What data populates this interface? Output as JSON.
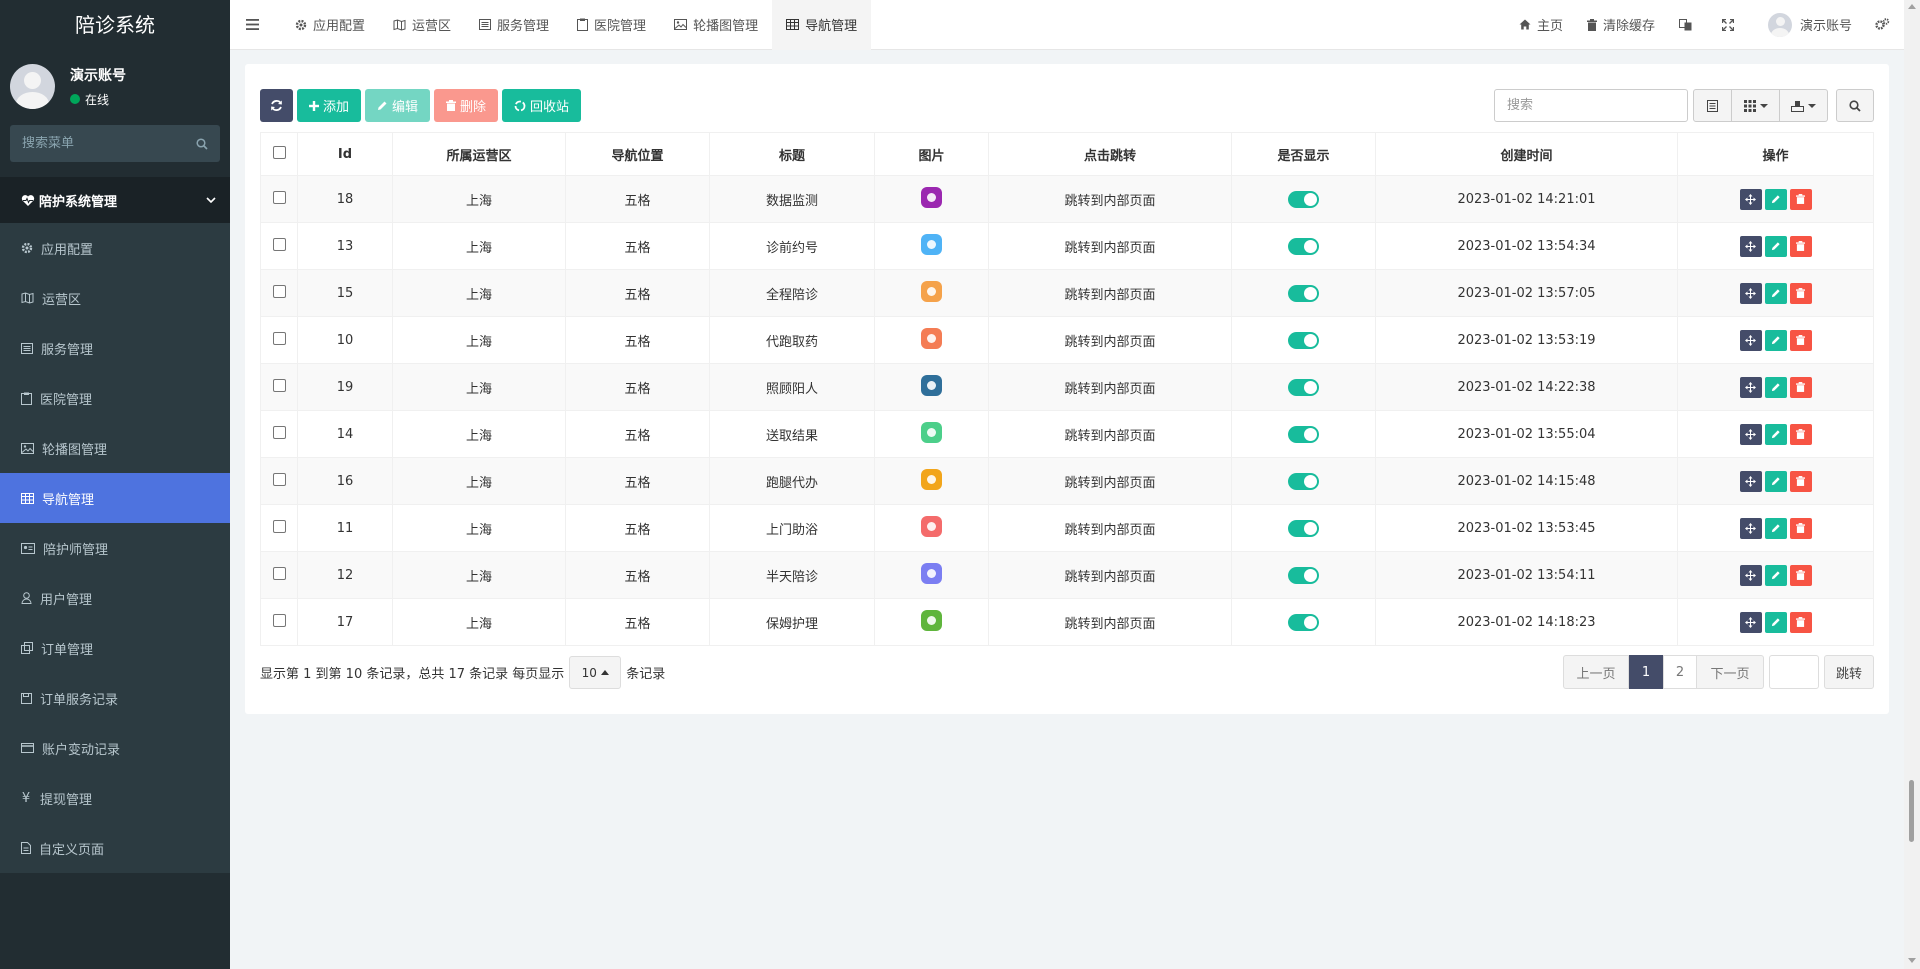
{
  "app": {
    "logo_title": "陪诊系统"
  },
  "user": {
    "name": "演示账号",
    "status": "在线"
  },
  "sidebar": {
    "search_placeholder": "搜索菜单",
    "group_label": "陪护系统管理",
    "items": [
      {
        "label": "应用配置",
        "icon": "gear-icon"
      },
      {
        "label": "运营区",
        "icon": "map-icon"
      },
      {
        "label": "服务管理",
        "icon": "list-icon"
      },
      {
        "label": "医院管理",
        "icon": "clipboard-icon"
      },
      {
        "label": "轮播图管理",
        "icon": "image-icon"
      },
      {
        "label": "导航管理",
        "icon": "table-icon",
        "active": true
      },
      {
        "label": "陪护师管理",
        "icon": "id-card-icon"
      },
      {
        "label": "用户管理",
        "icon": "user-icon"
      },
      {
        "label": "订单管理",
        "icon": "copy-icon"
      },
      {
        "label": "订单服务记录",
        "icon": "save-icon"
      },
      {
        "label": "账户变动记录",
        "icon": "credit-card-icon"
      },
      {
        "label": "提现管理",
        "icon": "yen-icon"
      },
      {
        "label": "自定义页面",
        "icon": "file-icon"
      }
    ]
  },
  "header": {
    "tabs": [
      {
        "label": "应用配置"
      },
      {
        "label": "运营区"
      },
      {
        "label": "服务管理"
      },
      {
        "label": "医院管理"
      },
      {
        "label": "轮播图管理"
      },
      {
        "label": "导航管理",
        "active": true
      }
    ],
    "home_label": "主页",
    "clear_cache_label": "清除缓存",
    "account_label": "演示账号"
  },
  "toolbar": {
    "add_label": "添加",
    "edit_label": "编辑",
    "delete_label": "删除",
    "recycle_label": "回收站",
    "search_placeholder": "搜索"
  },
  "table": {
    "columns": [
      "Id",
      "所属运营区",
      "导航位置",
      "标题",
      "图片",
      "点击跳转",
      "是否显示",
      "创建时间",
      "操作"
    ],
    "rows": [
      {
        "id": "18",
        "region": "上海",
        "position": "五格",
        "title": "数据监测",
        "icon_color": "#9b27b0",
        "jump": "跳转到内部页面",
        "time": "2023-01-02 14:21:01"
      },
      {
        "id": "13",
        "region": "上海",
        "position": "五格",
        "title": "诊前约号",
        "icon_color": "#4fb3f6",
        "jump": "跳转到内部页面",
        "time": "2023-01-02 13:54:34"
      },
      {
        "id": "15",
        "region": "上海",
        "position": "五格",
        "title": "全程陪诊",
        "icon_color": "#f5a24a",
        "jump": "跳转到内部页面",
        "time": "2023-01-02 13:57:05"
      },
      {
        "id": "10",
        "region": "上海",
        "position": "五格",
        "title": "代跑取药",
        "icon_color": "#f47c54",
        "jump": "跳转到内部页面",
        "time": "2023-01-02 13:53:19"
      },
      {
        "id": "19",
        "region": "上海",
        "position": "五格",
        "title": "照顾阳人",
        "icon_color": "#2f6f9a",
        "jump": "跳转到内部页面",
        "time": "2023-01-02 14:22:38"
      },
      {
        "id": "14",
        "region": "上海",
        "position": "五格",
        "title": "送取结果",
        "icon_color": "#4ccf8a",
        "jump": "跳转到内部页面",
        "time": "2023-01-02 13:55:04"
      },
      {
        "id": "16",
        "region": "上海",
        "position": "五格",
        "title": "跑腿代办",
        "icon_color": "#f2a51a",
        "jump": "跳转到内部页面",
        "time": "2023-01-02 14:15:48"
      },
      {
        "id": "11",
        "region": "上海",
        "position": "五格",
        "title": "上门助浴",
        "icon_color": "#f46b6b",
        "jump": "跳转到内部页面",
        "time": "2023-01-02 13:53:45"
      },
      {
        "id": "12",
        "region": "上海",
        "position": "五格",
        "title": "半天陪诊",
        "icon_color": "#7b7ef2",
        "jump": "跳转到内部页面",
        "time": "2023-01-02 13:54:11"
      },
      {
        "id": "17",
        "region": "上海",
        "position": "五格",
        "title": "保姆护理",
        "icon_color": "#5fb53c",
        "jump": "跳转到内部页面",
        "time": "2023-01-02 14:18:23"
      }
    ]
  },
  "pagination": {
    "info_prefix": "显示第 1 到第 10 条记录，总共 17 条记录 每页显示",
    "page_size": "10",
    "info_suffix": "条记录",
    "prev_label": "上一页",
    "pages": [
      "1",
      "2"
    ],
    "next_label": "下一页",
    "jump_label": "跳转"
  },
  "colors": {
    "primary": "#18bc9c",
    "danger": "#f75444",
    "dark": "#444c69",
    "active_menu": "#4e73df"
  }
}
